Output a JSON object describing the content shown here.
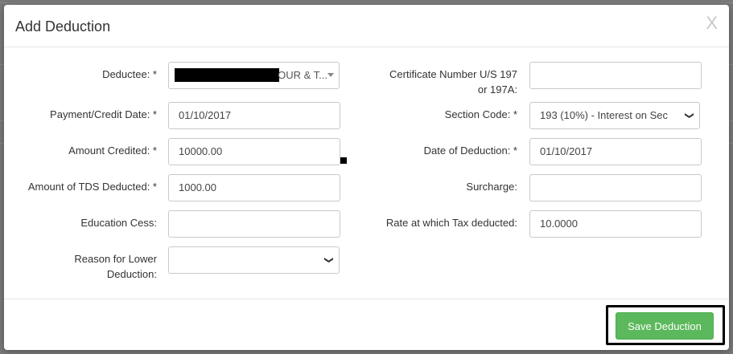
{
  "modal": {
    "title": "Add Deduction",
    "close_label": "X"
  },
  "form": {
    "deductee": {
      "label": "Deductee: *",
      "value": "OUR & T..."
    },
    "certificate_number": {
      "label_line1": "Certificate Number U/S 197",
      "label_line2": "or 197A:",
      "value": ""
    },
    "payment_date": {
      "label": "Payment/Credit Date: *",
      "value": "01/10/2017"
    },
    "section_code": {
      "label": "Section Code: *",
      "value": "193 (10%) - Interest on Sec"
    },
    "amount_credited": {
      "label": "Amount Credited: *",
      "value": "10000.00"
    },
    "date_of_deduction": {
      "label": "Date of Deduction: *",
      "value": "01/10/2017"
    },
    "tds_deducted": {
      "label": "Amount of TDS Deducted: *",
      "value": "1000.00"
    },
    "surcharge": {
      "label": "Surcharge:",
      "value": ""
    },
    "education_cess": {
      "label": "Education Cess:",
      "value": ""
    },
    "rate_tax_deducted": {
      "label": "Rate at which Tax deducted:",
      "value": "10.0000"
    },
    "reason_lower_deduction": {
      "label_line1": "Reason for Lower",
      "label_line2": "Deduction:",
      "value": ""
    }
  },
  "footer": {
    "save_label": "Save Deduction"
  },
  "colors": {
    "save_button": "#5cb85c",
    "overlay": "#7a7a7a"
  }
}
